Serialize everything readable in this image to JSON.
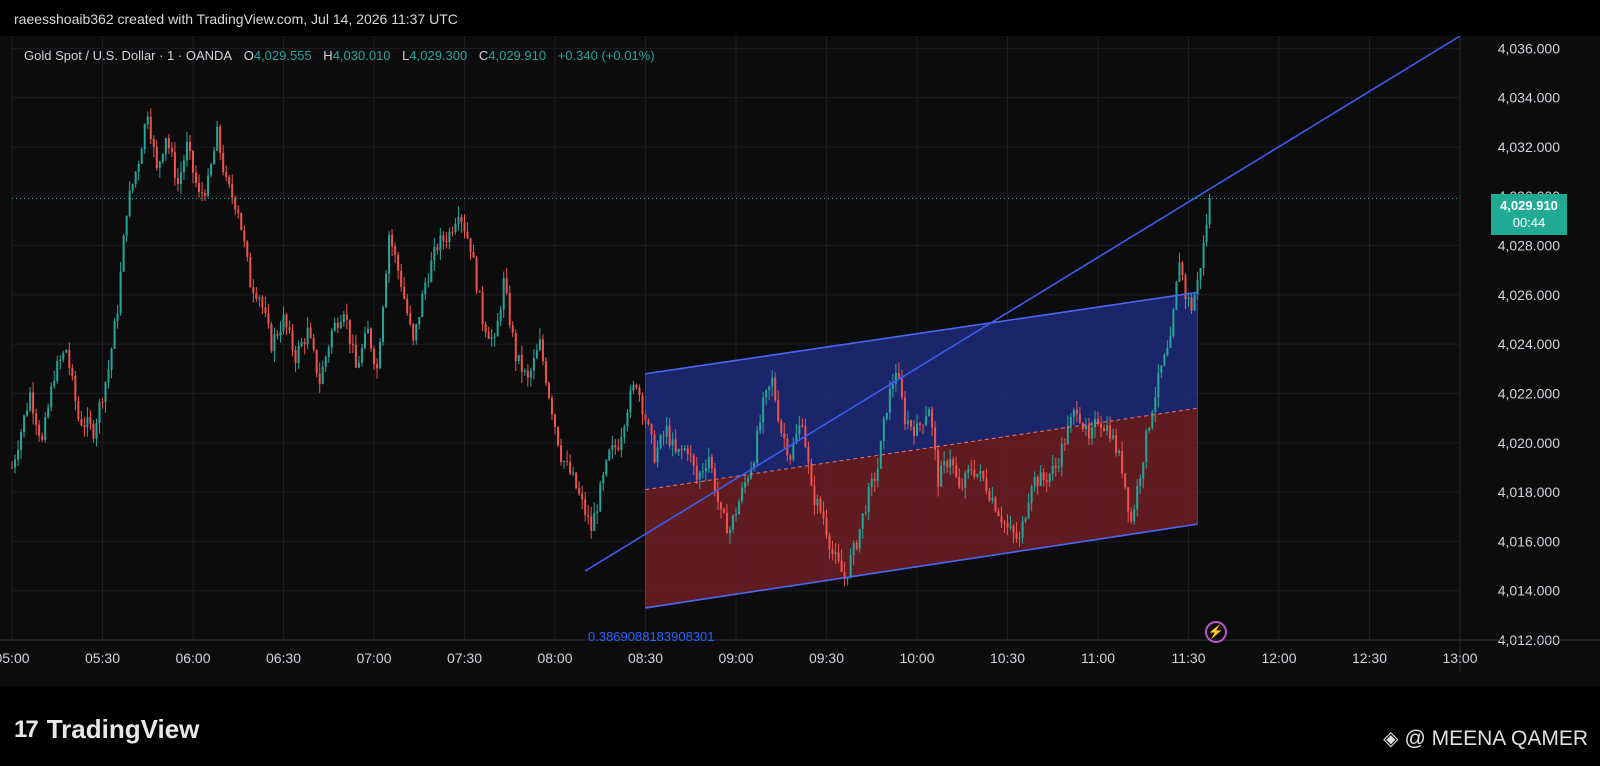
{
  "header": {
    "credit": "raeesshoaib362 created with TradingView.com, Jul 14, 2026 11:37 UTC"
  },
  "legend": {
    "symbol": "Gold Spot / U.S. Dollar · 1 · OANDA",
    "open_label": "O",
    "open": "4,029.555",
    "high_label": "H",
    "high": "4,030.010",
    "low_label": "L",
    "low": "4,029.300",
    "close_label": "C",
    "close": "4,029.910",
    "change": "+0.340 (+0.01%)"
  },
  "price_badge": {
    "price": "4,029.910",
    "countdown": "00:44"
  },
  "fib_label": "0.3869088183908301",
  "colors": {
    "up": "#26a69a",
    "down": "#ef5350",
    "trendline": "#3d5ced",
    "channel_top": "#1f2a7a",
    "channel_bottom": "#6e1f24",
    "badge": "#22ab94"
  },
  "icons": {
    "alert": "lightning-icon",
    "logo": "tradingview-logo-icon",
    "watermark": "binance-icon"
  },
  "footer": {
    "brand": "TradingView",
    "watermark": "@ MEENA QAMER"
  },
  "chart_data": {
    "type": "candlestick",
    "title": "Gold Spot / U.S. Dollar · 1 · OANDA",
    "x_ticks": [
      "05:00",
      "05:30",
      "06:00",
      "06:30",
      "07:00",
      "07:30",
      "08:00",
      "08:30",
      "09:00",
      "09:30",
      "10:00",
      "10:30",
      "11:00",
      "11:30",
      "12:00",
      "12:30",
      "13:00"
    ],
    "y_ticks": [
      "4,036.000",
      "4,034.000",
      "4,032.000",
      "4,030.000",
      "4,028.000",
      "4,026.000",
      "4,024.000",
      "4,022.000",
      "4,020.000",
      "4,018.000",
      "4,016.000",
      "4,014.000",
      "4,012.000"
    ],
    "ylim": [
      4012,
      4036.5
    ],
    "x_range_minutes": [
      300,
      780
    ],
    "grid": true,
    "last_price": 4029.91,
    "price_path": [
      [
        "05:00",
        4019.0
      ],
      [
        "05:03",
        4020.5
      ],
      [
        "05:06",
        4022.0
      ],
      [
        "05:10",
        4020.0
      ],
      [
        "05:14",
        4022.8
      ],
      [
        "05:18",
        4023.8
      ],
      [
        "05:22",
        4021.0
      ],
      [
        "05:27",
        4020.5
      ],
      [
        "05:32",
        4023.0
      ],
      [
        "05:35",
        4025.5
      ],
      [
        "05:38",
        4029.5
      ],
      [
        "05:42",
        4031.5
      ],
      [
        "05:45",
        4033.5
      ],
      [
        "05:48",
        4031.0
      ],
      [
        "05:51",
        4032.5
      ],
      [
        "05:55",
        4030.5
      ],
      [
        "05:58",
        4032.0
      ],
      [
        "06:02",
        4030.0
      ],
      [
        "06:05",
        4030.5
      ],
      [
        "06:08",
        4032.5
      ],
      [
        "06:11",
        4030.5
      ],
      [
        "06:15",
        4029.5
      ],
      [
        "06:19",
        4026.5
      ],
      [
        "06:22",
        4026.0
      ],
      [
        "06:26",
        4024.0
      ],
      [
        "06:30",
        4025.0
      ],
      [
        "06:34",
        4023.5
      ],
      [
        "06:38",
        4024.5
      ],
      [
        "06:42",
        4022.5
      ],
      [
        "06:46",
        4024.5
      ],
      [
        "06:50",
        4025.5
      ],
      [
        "06:54",
        4023.0
      ],
      [
        "06:58",
        4024.5
      ],
      [
        "07:01",
        4023.0
      ],
      [
        "07:05",
        4028.5
      ],
      [
        "07:09",
        4026.5
      ],
      [
        "07:13",
        4024.0
      ],
      [
        "07:17",
        4026.5
      ],
      [
        "07:21",
        4028.0
      ],
      [
        "07:25",
        4028.5
      ],
      [
        "07:28",
        4029.5
      ],
      [
        "07:32",
        4028.0
      ],
      [
        "07:36",
        4025.0
      ],
      [
        "07:40",
        4024.0
      ],
      [
        "07:43",
        4026.5
      ],
      [
        "07:47",
        4023.5
      ],
      [
        "07:51",
        4022.5
      ],
      [
        "07:55",
        4024.0
      ],
      [
        "07:58",
        4022.0
      ],
      [
        "08:02",
        4019.5
      ],
      [
        "08:06",
        4018.5
      ],
      [
        "08:09",
        4017.5
      ],
      [
        "08:12",
        4016.5
      ],
      [
        "08:15",
        4018.0
      ],
      [
        "08:18",
        4019.5
      ],
      [
        "08:21",
        4020.0
      ],
      [
        "08:24",
        4021.5
      ],
      [
        "08:27",
        4022.5
      ],
      [
        "08:30",
        4021.0
      ],
      [
        "08:33",
        4019.5
      ],
      [
        "08:37",
        4020.5
      ],
      [
        "08:40",
        4019.5
      ],
      [
        "08:44",
        4019.8
      ],
      [
        "08:47",
        4018.5
      ],
      [
        "08:51",
        4019.5
      ],
      [
        "08:55",
        4017.0
      ],
      [
        "08:58",
        4016.5
      ],
      [
        "09:02",
        4018.0
      ],
      [
        "09:06",
        4019.5
      ],
      [
        "09:09",
        4021.5
      ],
      [
        "09:12",
        4022.5
      ],
      [
        "09:15",
        4020.5
      ],
      [
        "09:18",
        4019.5
      ],
      [
        "09:22",
        4021.0
      ],
      [
        "09:25",
        4018.0
      ],
      [
        "09:29",
        4017.0
      ],
      [
        "09:32",
        4015.5
      ],
      [
        "09:36",
        4014.5
      ],
      [
        "09:40",
        4016.0
      ],
      [
        "09:43",
        4017.5
      ],
      [
        "09:47",
        4019.0
      ],
      [
        "09:50",
        4021.5
      ],
      [
        "09:53",
        4023.0
      ],
      [
        "09:56",
        4021.0
      ],
      [
        "10:00",
        4020.5
      ],
      [
        "10:04",
        4021.5
      ],
      [
        "10:07",
        4018.5
      ],
      [
        "10:11",
        4019.5
      ],
      [
        "10:14",
        4018.0
      ],
      [
        "10:18",
        4019.0
      ],
      [
        "10:22",
        4018.5
      ],
      [
        "10:26",
        4017.5
      ],
      [
        "10:30",
        4016.5
      ],
      [
        "10:34",
        4016.0
      ],
      [
        "10:38",
        4018.5
      ],
      [
        "10:42",
        4018.5
      ],
      [
        "10:46",
        4019.0
      ],
      [
        "10:50",
        4020.5
      ],
      [
        "10:53",
        4021.5
      ],
      [
        "10:57",
        4020.0
      ],
      [
        "11:00",
        4021.0
      ],
      [
        "11:04",
        4020.5
      ],
      [
        "11:08",
        4019.0
      ],
      [
        "11:11",
        4016.8
      ],
      [
        "11:15",
        4019.5
      ],
      [
        "11:18",
        4021.5
      ],
      [
        "11:21",
        4023.0
      ],
      [
        "11:24",
        4024.0
      ],
      [
        "11:27",
        4027.5
      ],
      [
        "11:29",
        4026.0
      ],
      [
        "11:31",
        4025.5
      ],
      [
        "11:33",
        4026.5
      ],
      [
        "11:35",
        4028.0
      ],
      [
        "11:37",
        4029.91
      ]
    ],
    "channel": {
      "upper": [
        [
          "08:30",
          4022.8
        ],
        [
          "11:33",
          4026.1
        ]
      ],
      "lower": [
        [
          "08:30",
          4013.3
        ],
        [
          "11:33",
          4016.7
        ]
      ],
      "mid": [
        [
          "08:30",
          4018.1
        ],
        [
          "11:33",
          4021.4
        ]
      ]
    },
    "trendline": [
      [
        "08:10",
        4014.8
      ],
      [
        "13:00",
        4036.5
      ]
    ]
  }
}
